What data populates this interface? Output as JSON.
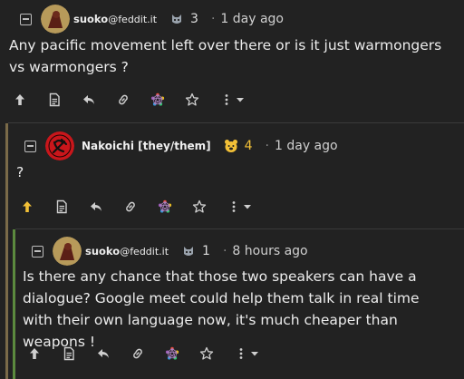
{
  "comments": [
    {
      "user": "suoko",
      "host": "@feddit.it",
      "score": "3",
      "time": "1 day ago",
      "body": "Any pacific movement left over there or is it just warmongers vs warmongers ?"
    },
    {
      "user": "Nakoichi [they/them]",
      "score": "4",
      "time": "1 day ago",
      "body": "?"
    },
    {
      "user": "suoko",
      "host": "@feddit.it",
      "score": "1",
      "time": "8 hours ago",
      "body": "Is there any chance that those two speakers can have a dialogue? Google meet could help them talk in real time with their own language now, it's much cheaper than weapons !"
    }
  ],
  "dot": "·",
  "colors": {
    "background": "#222222",
    "thread_line_1": "#7a6a48",
    "thread_line_2": "#5b8a3e",
    "upvote_active": "#f2c037",
    "score_gold": "#f2c037"
  },
  "icons": [
    "collapse-icon",
    "bot-icon",
    "bear-icon",
    "upvote-icon",
    "source-icon",
    "reply-icon",
    "link-icon",
    "fediverse-icon",
    "star-icon",
    "more-icon",
    "chevron-down-icon"
  ]
}
